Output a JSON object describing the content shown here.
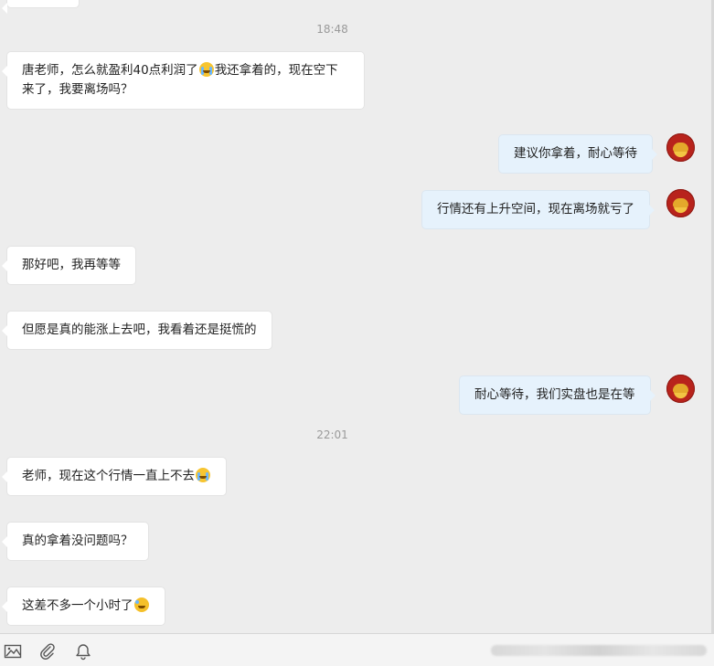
{
  "timestamps": [
    "18:48",
    "22:01"
  ],
  "messages": [
    {
      "side": "left",
      "text_a": "唐老师，怎么就盈利40点利润了",
      "emoji": "crying-face-icon",
      "text_b": "我还拿着的，现在空下来了，我要离场吗？"
    },
    {
      "side": "right",
      "text": "建议你拿着，耐心等待"
    },
    {
      "side": "right",
      "text": "行情还有上升空间，现在离场就亏了"
    },
    {
      "side": "left",
      "text": "那好吧，我再等等"
    },
    {
      "side": "left",
      "text": "但愿是真的能涨上去吧，我看着还是挺慌的"
    },
    {
      "side": "right",
      "text": "耐心等待，我们实盘也是在等"
    },
    {
      "side": "left",
      "text": "老师，现在这个行情一直上不去",
      "emoji": "crying-face-icon"
    },
    {
      "side": "left",
      "text": "真的拿着没问题吗？"
    },
    {
      "side": "left",
      "text": "这差不多一个小时了",
      "emoji": "laughing-face-icon"
    }
  ],
  "toolbar": {
    "icons": [
      "image-icon",
      "paperclip-icon",
      "bell-icon"
    ]
  },
  "colors": {
    "background": "#ededed",
    "left_bubble": "#ffffff",
    "right_bubble": "#e6f2fc",
    "timestamp": "#9a9a9a"
  }
}
